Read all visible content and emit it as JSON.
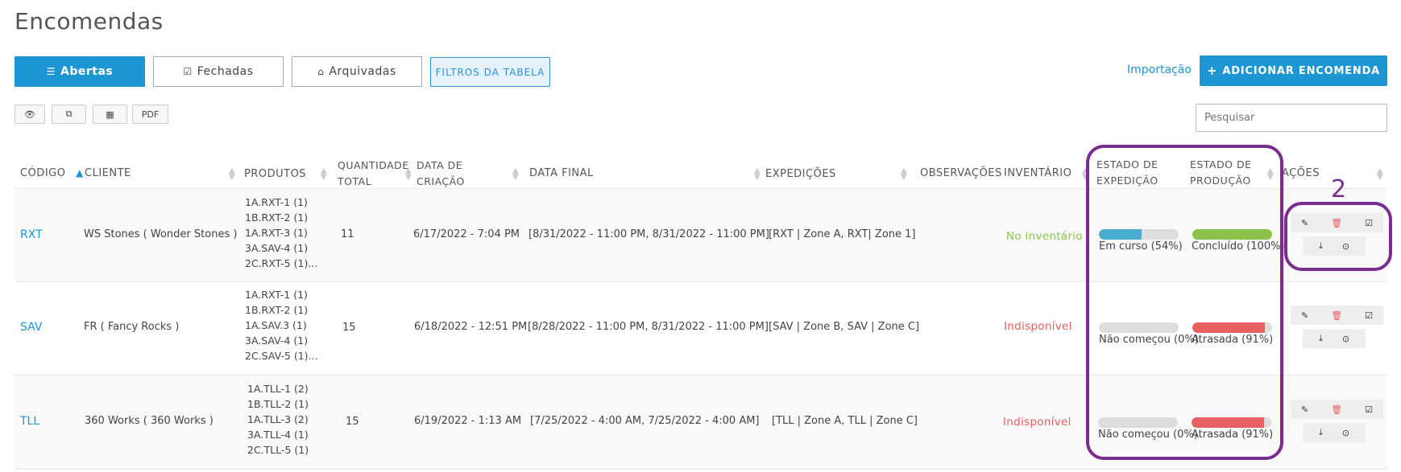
{
  "page": {
    "title": "Encomendas"
  },
  "tabs": [
    {
      "label": "Abertas",
      "icon": "list-icon",
      "active": true
    },
    {
      "label": "Fechadas",
      "icon": "check-square-icon",
      "active": false
    },
    {
      "label": "Arquivadas",
      "icon": "archive-icon",
      "active": false
    }
  ],
  "filters_label": "FILTROS DA TABELA",
  "import_label": "Importação",
  "add_label": "ADICIONAR ENCOMENDA",
  "tools": {
    "pdf_label": "PDF"
  },
  "search": {
    "placeholder": "Pesquisar"
  },
  "columns": {
    "codigo": "CÓDIGO",
    "cliente": "CLIENTE",
    "produtos": "PRODUTOS",
    "quantidade_1": "QUANTIDADE",
    "quantidade_2": "TOTAL",
    "data_criacao_1": "DATA DE",
    "data_criacao_2": "CRIAÇÃO",
    "data_final": "DATA FINAL",
    "expedicoes": "EXPEDIÇÕES",
    "observacoes": "OBSERVAÇÕES",
    "inventario": "INVENTÁRIO",
    "estado_exp_1": "ESTADO DE",
    "estado_exp_2": "EXPEDIÇÃO",
    "estado_prod_1": "ESTADO DE",
    "estado_prod_2": "PRODUÇÃO",
    "acoes": "AÇÕES"
  },
  "rows": [
    {
      "code": "RXT",
      "client": "WS Stones ( Wonder Stones )",
      "products": [
        "1A.RXT-1 (1)",
        "1B.RXT-2 (1)",
        "1A.RXT-3 (1)",
        "3A.SAV-4 (1)",
        "2C.RXT-5 (1)..."
      ],
      "quantity": "11",
      "created": "6/17/2022 - 7:04 PM",
      "final": "[8/31/2022 - 11:00 PM, 8/31/2022 - 11:00 PM]",
      "expeditions": "[RXT | Zone A, RXT| Zone 1]",
      "inventory": "No inventário",
      "inventory_status": "ok",
      "exp_state": "Em curso (54%)",
      "exp_pct": 54,
      "exp_color": "#4aaed0",
      "prod_state": "Concluído (100%)",
      "prod_pct": 100,
      "prod_color": "#8bc34a"
    },
    {
      "code": "SAV",
      "client": "FR ( Fancy Rocks )",
      "products": [
        "1A.RXT-1 (1)",
        "1B.RXT-2 (1)",
        "1A.SAV.3 (1)",
        "3A.SAV-4 (1)",
        "2C.SAV-5 (1)..."
      ],
      "quantity": "15",
      "created": "6/18/2022 - 12:51 PM",
      "final": "[8/28/2022 - 11:00 PM, 8/31/2022 - 11:00 PM]",
      "expeditions": "[SAV | Zone B, SAV | Zone C]",
      "inventory": "Indisponível",
      "inventory_status": "bad",
      "exp_state": "Não começou (0%)",
      "exp_pct": 0,
      "exp_color": "#4aaed0",
      "prod_state": "Atrasada (91%)",
      "prod_pct": 91,
      "prod_color": "#e96060"
    },
    {
      "code": "TLL",
      "client": "360 Works ( 360 Works )",
      "products": [
        "1A.TLL-1 (2)",
        "1B.TLL-2 (1)",
        "1A.TLL-3 (2)",
        "3A.TLL-4 (1)",
        "2C.TLL-5 (1)"
      ],
      "quantity": "15",
      "created": "6/19/2022 - 1:13 AM",
      "final": "[7/25/2022 - 4:00 AM, 7/25/2022 - 4:00  AM]",
      "expeditions": "[TLL | Zone A, TLL | Zone C]",
      "inventory": "Indisponível",
      "inventory_status": "bad",
      "exp_state": "Não começou (0%)",
      "exp_pct": 0,
      "exp_color": "#4aaed0",
      "prod_state": "Atrasada (91%)",
      "prod_pct": 91,
      "prod_color": "#e96060"
    }
  ],
  "annotation": {
    "label": "2",
    "color": "#7b2c8f"
  }
}
